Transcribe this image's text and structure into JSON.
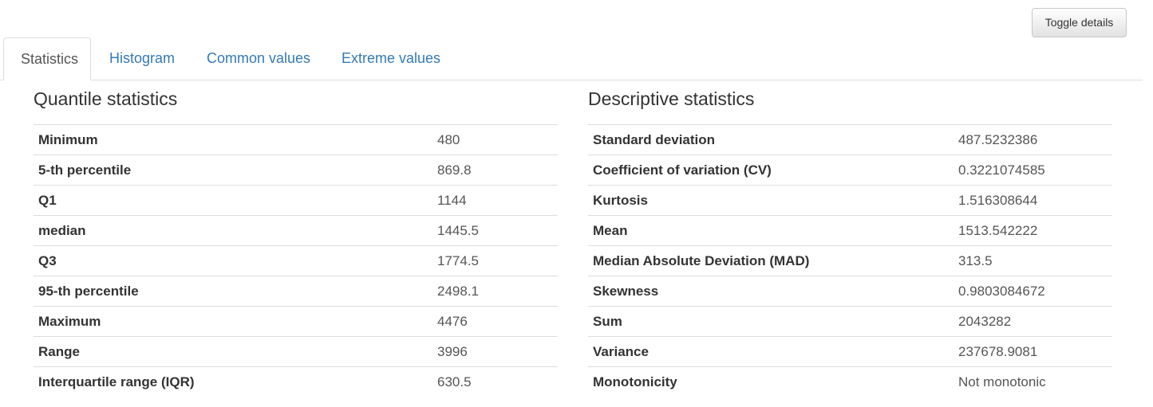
{
  "toggle_button_label": "Toggle details",
  "tabs": [
    {
      "label": "Statistics",
      "active": true
    },
    {
      "label": "Histogram",
      "active": false
    },
    {
      "label": "Common values",
      "active": false
    },
    {
      "label": "Extreme values",
      "active": false
    }
  ],
  "quantile": {
    "title": "Quantile statistics",
    "rows": [
      {
        "label": "Minimum",
        "value": "480"
      },
      {
        "label": "5-th percentile",
        "value": "869.8"
      },
      {
        "label": "Q1",
        "value": "1144"
      },
      {
        "label": "median",
        "value": "1445.5"
      },
      {
        "label": "Q3",
        "value": "1774.5"
      },
      {
        "label": "95-th percentile",
        "value": "2498.1"
      },
      {
        "label": "Maximum",
        "value": "4476"
      },
      {
        "label": "Range",
        "value": "3996"
      },
      {
        "label": "Interquartile range (IQR)",
        "value": "630.5"
      }
    ]
  },
  "descriptive": {
    "title": "Descriptive statistics",
    "rows": [
      {
        "label": "Standard deviation",
        "value": "487.5232386"
      },
      {
        "label": "Coefficient of variation (CV)",
        "value": "0.3221074585"
      },
      {
        "label": "Kurtosis",
        "value": "1.516308644"
      },
      {
        "label": "Mean",
        "value": "1513.542222"
      },
      {
        "label": "Median Absolute Deviation (MAD)",
        "value": "313.5"
      },
      {
        "label": "Skewness",
        "value": "0.9803084672"
      },
      {
        "label": "Sum",
        "value": "2043282"
      },
      {
        "label": "Variance",
        "value": "237678.9081"
      },
      {
        "label": "Monotonicity",
        "value": "Not monotonic"
      }
    ]
  },
  "colors": {
    "link": "#337ab7",
    "border": "#dddddd",
    "text": "#333333"
  }
}
